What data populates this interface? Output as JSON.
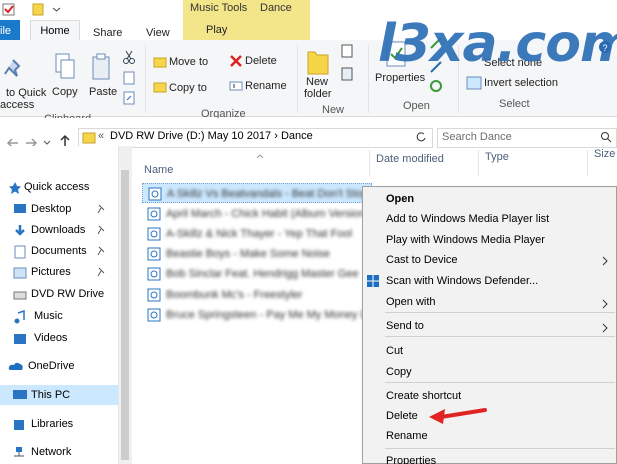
{
  "titlebar": {
    "contextual_group": "Music Tools",
    "window_title": "Dance"
  },
  "tabs": {
    "file": "ile",
    "home": "Home",
    "share": "Share",
    "view": "View",
    "play": "Play"
  },
  "ribbon": {
    "pin_label_1": "to Quick",
    "pin_label_2": "access",
    "copy": "Copy",
    "paste": "Paste",
    "clipboard_group": "Clipboard",
    "move_to": "Move to",
    "copy_to": "Copy to",
    "delete": "Delete",
    "rename": "Rename",
    "organize_group": "Organize",
    "new_folder_1": "New",
    "new_folder_2": "folder",
    "new_group": "New",
    "properties": "Properties",
    "open_group": "Open",
    "select_none": "Select none",
    "invert_selection": "Invert selection",
    "select_group": "Select"
  },
  "address": {
    "path": "DVD RW Drive (D:) May 10 2017  ›  Dance",
    "search_placeholder": "Search Dance"
  },
  "nav": {
    "quick_access": "Quick access",
    "desktop": "Desktop",
    "downloads": "Downloads",
    "documents": "Documents",
    "pictures": "Pictures",
    "dvd": "DVD RW Drive",
    "music": "Music",
    "videos": "Videos",
    "onedrive": "OneDrive",
    "this_pc": "This PC",
    "libraries": "Libraries",
    "network": "Network"
  },
  "columns": {
    "name": "Name",
    "date": "Date modified",
    "type": "Type",
    "size": "Size"
  },
  "files": [
    {
      "name": "A Skillz Vs Beatvandals - Beat Don't Stop"
    },
    {
      "name": "April March - Chick Habit (Album Version)"
    },
    {
      "name": "A-Skillz & Nick Thayer - Yep That Fool"
    },
    {
      "name": "Beastie Boys - Make Some Noise"
    },
    {
      "name": "Bob Sinclar Feat. Hendrigg Master Gee"
    },
    {
      "name": "Boombunk Mc's - Freestyler"
    },
    {
      "name": "Bruce Springsteen - Pay Me My Money Down"
    }
  ],
  "context_menu": {
    "open": "Open",
    "add_wmp": "Add to Windows Media Player list",
    "play_wmp": "Play with Windows Media Player",
    "cast": "Cast to Device",
    "scan": "Scan with Windows Defender...",
    "open_with": "Open with",
    "send_to": "Send to",
    "cut": "Cut",
    "copy": "Copy",
    "create_shortcut": "Create shortcut",
    "delete": "Delete",
    "rename": "Rename",
    "properties": "Properties"
  },
  "watermark": "l3xa.com",
  "colors": {
    "accent": "#1979ca",
    "selection": "#cce8ff",
    "context_tab": "#f3e58a",
    "arrow": "#e02424"
  }
}
